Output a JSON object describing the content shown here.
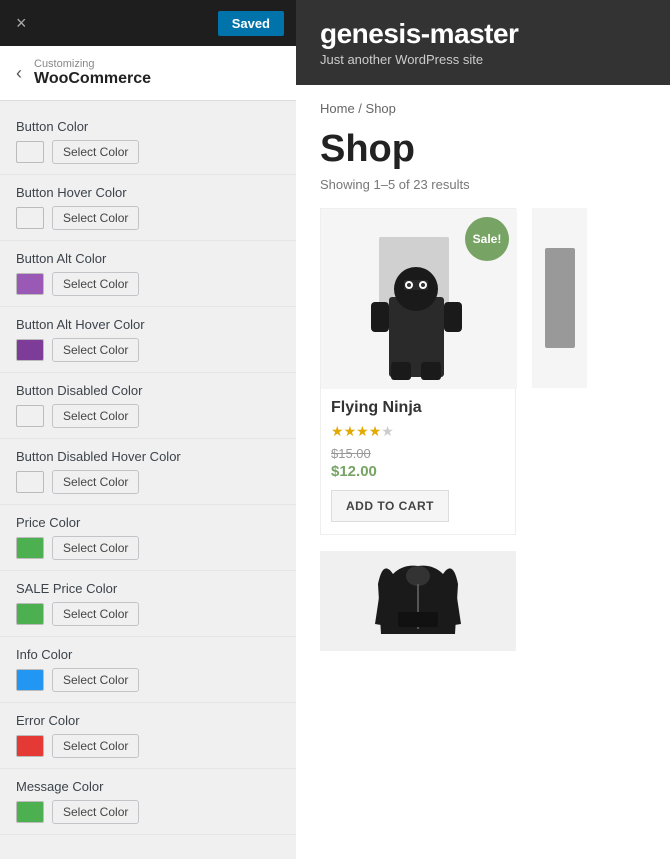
{
  "topBar": {
    "closeLabel": "×",
    "savedLabel": "Saved"
  },
  "header": {
    "backLabel": "‹",
    "customizingLabel": "Customizing",
    "woocommerceLabel": "WooCommerce"
  },
  "settings": [
    {
      "id": "button-color",
      "label": "Button Color",
      "color": "#f0f0f1",
      "selectLabel": "Select Color"
    },
    {
      "id": "button-hover-color",
      "label": "Button Hover Color",
      "color": "#f0f0f1",
      "selectLabel": "Select Color"
    },
    {
      "id": "button-alt-color",
      "label": "Button Alt Color",
      "color": "#9b59b6",
      "selectLabel": "Select Color"
    },
    {
      "id": "button-alt-hover-color",
      "label": "Button Alt Hover Color",
      "color": "#7d3c98",
      "selectLabel": "Select Color"
    },
    {
      "id": "button-disabled-color",
      "label": "Button Disabled Color",
      "color": "#f0f0f1",
      "selectLabel": "Select Color"
    },
    {
      "id": "button-disabled-hover-color",
      "label": "Button Disabled Hover Color",
      "color": "#f0f0f1",
      "selectLabel": "Select Color"
    },
    {
      "id": "price-color",
      "label": "Price Color",
      "color": "#4caf50",
      "selectLabel": "Select Color"
    },
    {
      "id": "sale-price-color",
      "label": "SALE Price Color",
      "color": "#4caf50",
      "selectLabel": "Select Color"
    },
    {
      "id": "info-color",
      "label": "Info Color",
      "color": "#2196f3",
      "selectLabel": "Select Color"
    },
    {
      "id": "error-color",
      "label": "Error Color",
      "color": "#e53935",
      "selectLabel": "Select Color"
    },
    {
      "id": "message-color",
      "label": "Message Color",
      "color": "#4caf50",
      "selectLabel": "Select Color"
    }
  ],
  "siteHeader": {
    "title": "genesis-master",
    "tagline": "Just another WordPress site"
  },
  "shop": {
    "breadcrumb": "Home / Shop",
    "breadcrumbHome": "Home",
    "breadcrumbSep": " / ",
    "breadcrumbShop": "Shop",
    "title": "Shop",
    "showingResults": "Showing 1–5 of 23 results"
  },
  "products": [
    {
      "id": "flying-ninja",
      "name": "Flying Ninja",
      "saleBadge": "Sale!",
      "originalPrice": "$15.00",
      "salePrice": "$12.00",
      "stars": 4,
      "maxStars": 5,
      "addToCartLabel": "ADD TO CART"
    }
  ]
}
